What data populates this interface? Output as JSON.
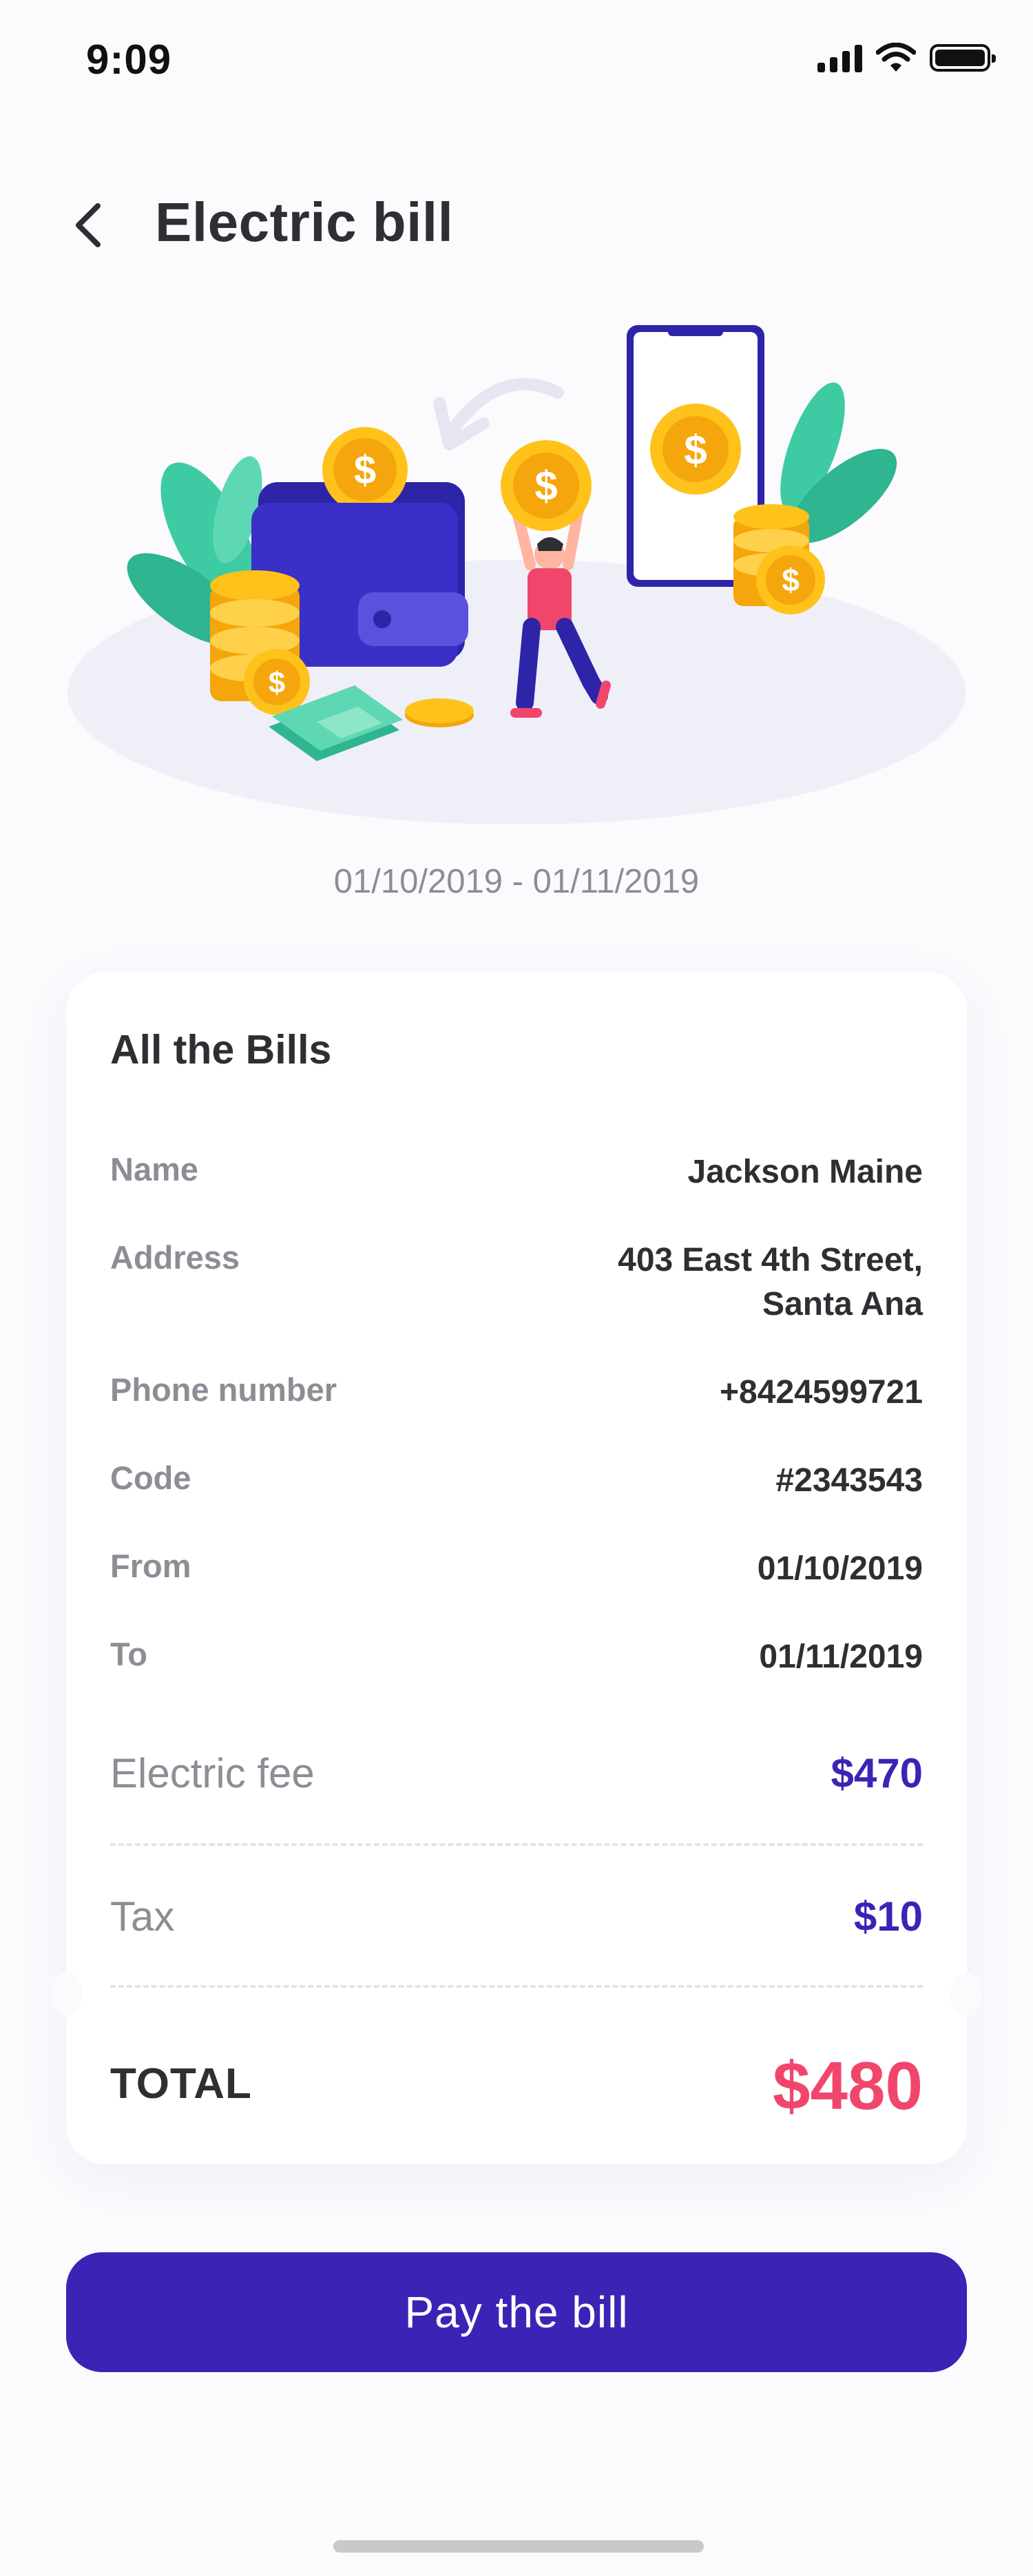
{
  "status_bar": {
    "time": "9:09",
    "icons": [
      "signal-icon",
      "wifi-icon",
      "battery-icon"
    ]
  },
  "header": {
    "title": "Electric bill",
    "back_icon": "chevron-left-icon"
  },
  "illustration": {
    "icons": [
      "wallet-icon",
      "coin-icon",
      "phone-icon",
      "banknotes-icon",
      "person-icon",
      "leaf-icon",
      "arrow-icon"
    ]
  },
  "date_range": "01/10/2019 - 01/11/2019",
  "card": {
    "title": "All the Bills",
    "rows": [
      {
        "label": "Name",
        "value": "Jackson Maine"
      },
      {
        "label": "Address",
        "value_line1": "403 East 4th Street,",
        "value_line2": "Santa Ana"
      },
      {
        "label": "Phone number",
        "value": "+8424599721"
      },
      {
        "label": "Code",
        "value": "#2343543"
      },
      {
        "label": "From",
        "value": "01/10/2019"
      },
      {
        "label": "To",
        "value": "01/11/2019"
      }
    ],
    "fees": [
      {
        "label": "Electric fee",
        "value": "$470"
      },
      {
        "label": "Tax",
        "value": "$10"
      }
    ],
    "total": {
      "label": "TOTAL",
      "value": "$480"
    }
  },
  "pay_button": {
    "label": "Pay the bill"
  },
  "colors": {
    "primary": "#3a24b6",
    "total": "#f1466c",
    "background": "#fbfbfe",
    "muted_text": "#8d8d95"
  }
}
